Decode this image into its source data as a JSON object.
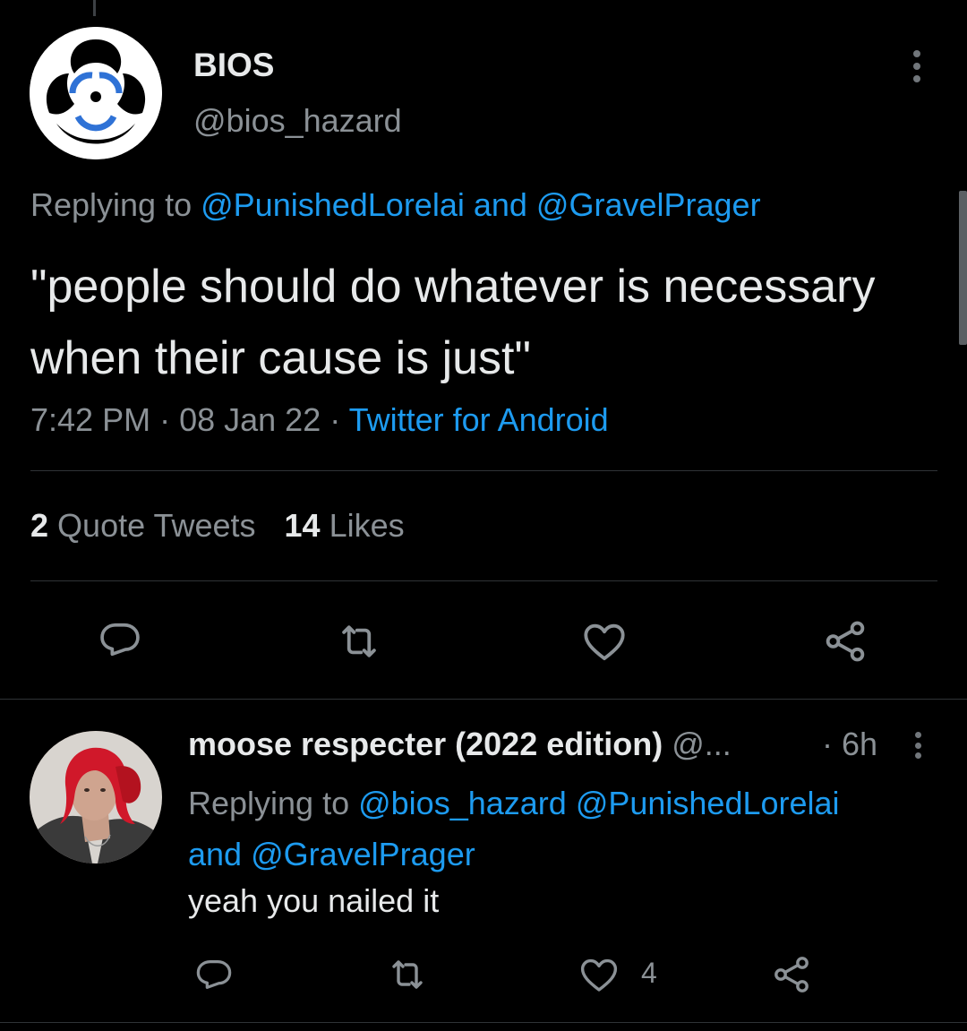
{
  "main_tweet": {
    "author_name": "BIOS",
    "author_handle": "@bios_hazard",
    "replying_prefix": "Replying to ",
    "replying_mention_1": "@PunishedLorelai",
    "replying_joiner": " and ",
    "replying_mention_2": "@GravelPrager",
    "text": "\"people should do whatever is necessary when their cause is just\"",
    "time": "7:42 PM",
    "separator": " · ",
    "date": "08 Jan 22",
    "source": "Twitter for Android",
    "quote_count": "2",
    "quote_label": "Quote Tweets",
    "like_count": "14",
    "like_label": "Likes",
    "icons": {
      "reply": "reply-icon",
      "retweet": "retweet-icon",
      "like": "heart-icon",
      "share": "share-icon",
      "more": "more-icon"
    }
  },
  "reply_tweet": {
    "author_name": "moose respecter (2022 edition)",
    "author_handle": "@...",
    "time": "· 6h",
    "replying_prefix": "Replying to ",
    "replying_mention_1": "@bios_hazard",
    "replying_space": " ",
    "replying_mention_2": "@PunishedLorelai",
    "replying_joiner": "and ",
    "replying_mention_3": "@GravelPrager",
    "text": "yeah you nailed it",
    "like_count": "4"
  },
  "colors": {
    "background": "#000000",
    "text_primary": "#e7e9ea",
    "text_secondary": "#8b9196",
    "link": "#1d9bf0",
    "divider": "#2f3336",
    "icon": "#8b9196"
  }
}
